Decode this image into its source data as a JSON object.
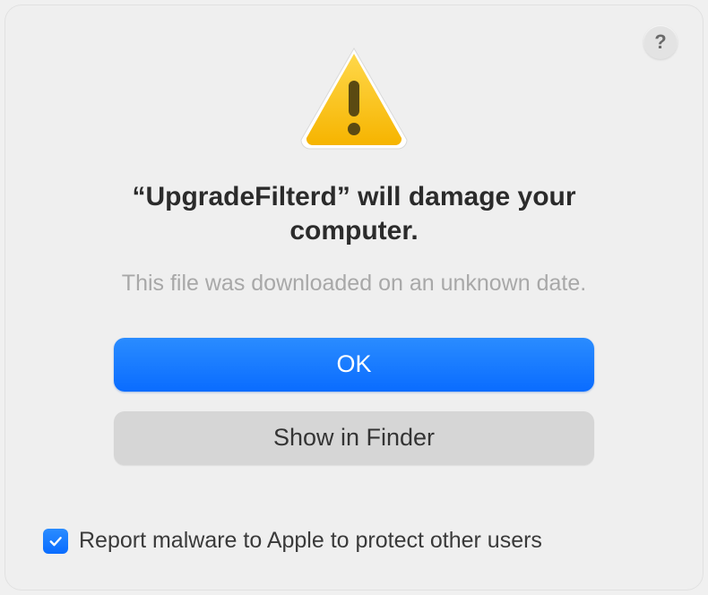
{
  "dialog": {
    "help_tooltip": "?",
    "title_prefix": "“",
    "app_name": "UpgradeFilterd",
    "title_suffix": "” will damage your computer.",
    "subtitle": "This file was downloaded on an unknown date.",
    "ok_label": "OK",
    "show_in_finder_label": "Show in Finder",
    "report_checkbox_label": "Report malware to Apple to protect other users",
    "report_checked": true
  }
}
